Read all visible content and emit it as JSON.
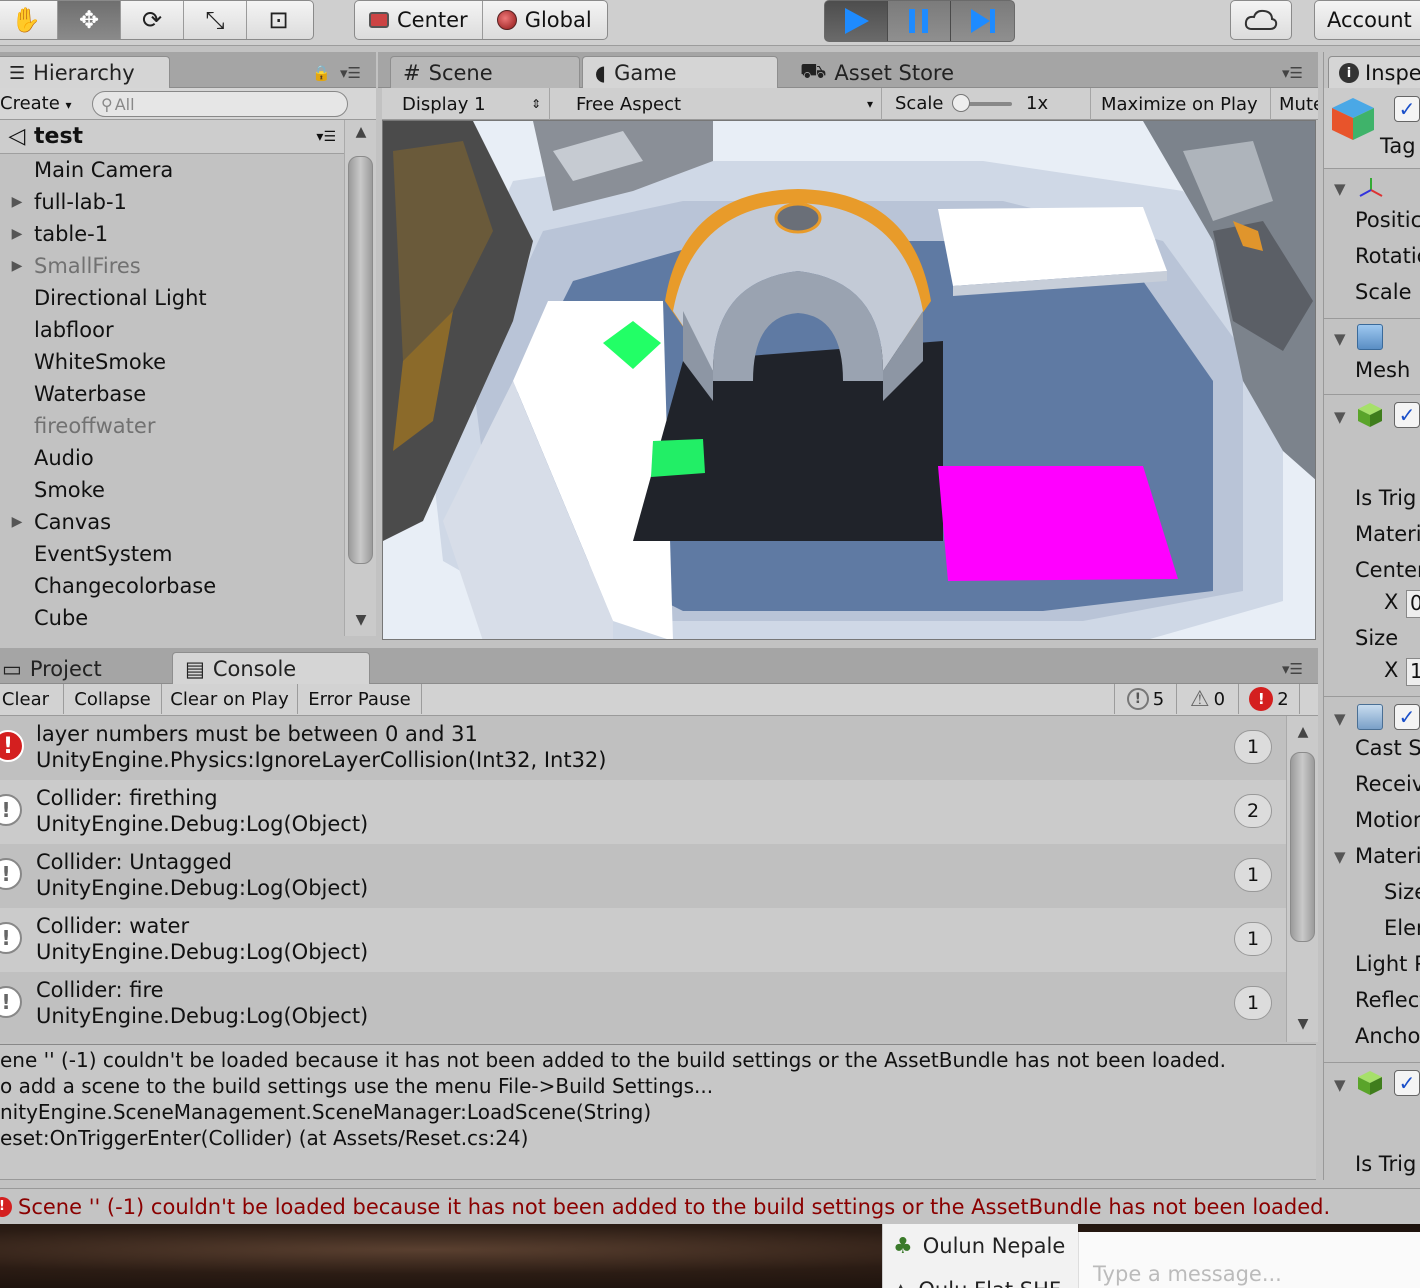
{
  "toolbar": {
    "pivot_label": "Center",
    "space_label": "Global",
    "account_label": "Account"
  },
  "hierarchy": {
    "tab_label": "Hierarchy",
    "create_label": "Create",
    "search_placeholder": "All",
    "scene_name": "test",
    "items": [
      {
        "label": "Main Camera",
        "expandable": false,
        "disabled": false
      },
      {
        "label": "full-lab-1",
        "expandable": true,
        "disabled": false
      },
      {
        "label": "table-1",
        "expandable": true,
        "disabled": false
      },
      {
        "label": "SmallFires",
        "expandable": true,
        "disabled": true
      },
      {
        "label": "Directional Light",
        "expandable": false,
        "disabled": false
      },
      {
        "label": "labfloor",
        "expandable": false,
        "disabled": false
      },
      {
        "label": "WhiteSmoke",
        "expandable": false,
        "disabled": false
      },
      {
        "label": "Waterbase",
        "expandable": false,
        "disabled": false
      },
      {
        "label": "fireoffwater",
        "expandable": false,
        "disabled": true
      },
      {
        "label": "Audio",
        "expandable": false,
        "disabled": false
      },
      {
        "label": "Smoke",
        "expandable": false,
        "disabled": false
      },
      {
        "label": "Canvas",
        "expandable": true,
        "disabled": false
      },
      {
        "label": "EventSystem",
        "expandable": false,
        "disabled": false
      },
      {
        "label": "Changecolorbase",
        "expandable": false,
        "disabled": false
      },
      {
        "label": "Cube",
        "expandable": false,
        "disabled": false
      }
    ]
  },
  "view_tabs": {
    "scene": "Scene",
    "game": "Game",
    "asset_store": "Asset Store"
  },
  "game": {
    "display": "Display 1",
    "aspect": "Free Aspect",
    "scale_label": "Scale",
    "scale_value": "1x",
    "maximize_label": "Maximize on Play",
    "mute_label": "Mute"
  },
  "console": {
    "project_tab": "Project",
    "console_tab": "Console",
    "clear": "Clear",
    "collapse": "Collapse",
    "clear_on_play": "Clear on Play",
    "error_pause": "Error Pause",
    "info_count": "5",
    "warning_count": "0",
    "error_count": "2",
    "logs": [
      {
        "type": "error",
        "line1": "layer numbers must be between 0 and 31",
        "line2": "UnityEngine.Physics:IgnoreLayerCollision(Int32, Int32)",
        "count": "1"
      },
      {
        "type": "info",
        "line1": "Collider: firething",
        "line2": "UnityEngine.Debug:Log(Object)",
        "count": "2"
      },
      {
        "type": "info",
        "line1": "Collider: Untagged",
        "line2": "UnityEngine.Debug:Log(Object)",
        "count": "1"
      },
      {
        "type": "info",
        "line1": "Collider: water",
        "line2": "UnityEngine.Debug:Log(Object)",
        "count": "1"
      },
      {
        "type": "info",
        "line1": "Collider: fire",
        "line2": "UnityEngine.Debug:Log(Object)",
        "count": "1"
      }
    ],
    "detail": [
      "ene '' (-1) couldn't be loaded because it has not been added to the build settings or the AssetBundle has not been loaded.",
      "o add a scene to the build settings use the menu File->Build Settings...",
      "nityEngine.SceneManagement.SceneManager:LoadScene(String)",
      "eset:OnTriggerEnter(Collider) (at Assets/Reset.cs:24)"
    ]
  },
  "inspector": {
    "tab_label": "Inspe",
    "tag_label": "Tag",
    "position": "Positic",
    "rotation": "Rotatic",
    "scale": "Scale",
    "mesh": "Mesh",
    "is_trigger": "Is Trig",
    "material": "Materi",
    "center": "Center",
    "x": "X",
    "center_x_value": "0",
    "size": "Size",
    "size_x_value": "1",
    "cast_shadows": "Cast S",
    "receive": "Receiv",
    "motion": "Motior",
    "materials": "Materi",
    "size2": "Size",
    "element": "Elen",
    "light_probes": "Light P",
    "reflection": "Reflect",
    "anchor": "Ancho",
    "is_trigger2": "Is Trig"
  },
  "status_bar": {
    "message": "Scene '' (-1) couldn't be loaded because it has not been added to the build settings or the AssetBundle has not been loaded."
  },
  "desktop": {
    "notification_sender": "Oulun Nepale",
    "notification_sender2": "Oulu Flat SHF",
    "message_placeholder": "Type a message..."
  }
}
